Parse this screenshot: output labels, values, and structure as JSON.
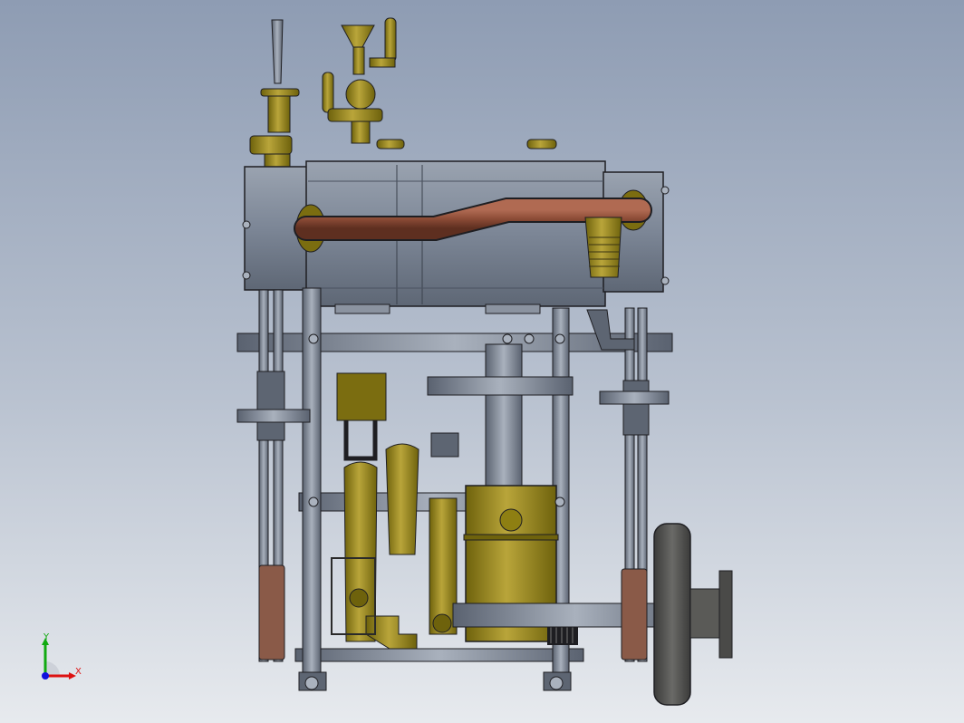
{
  "viewport": {
    "background_top": "#8e9cb3",
    "background_bottom": "#e7eaee"
  },
  "model": {
    "colors": {
      "steel": "#7c8696",
      "steel_dark": "#4e5663",
      "steel_light": "#a9b1bd",
      "brass": "#8e7f12",
      "brass_light": "#b9a53a",
      "copper": "#8a4a35",
      "copper_light": "#b06a52",
      "flywheel": "#4a4a48",
      "outline": "#1e1e22"
    },
    "icons": [
      "cylinder-block",
      "steam-pipe",
      "valve-assembly",
      "flywheel",
      "pump",
      "frame-columns"
    ]
  },
  "triad": {
    "x_label": "X",
    "y_label": "Y",
    "x_color": "#d11",
    "y_color": "#1a1",
    "z_color": "#11d"
  }
}
